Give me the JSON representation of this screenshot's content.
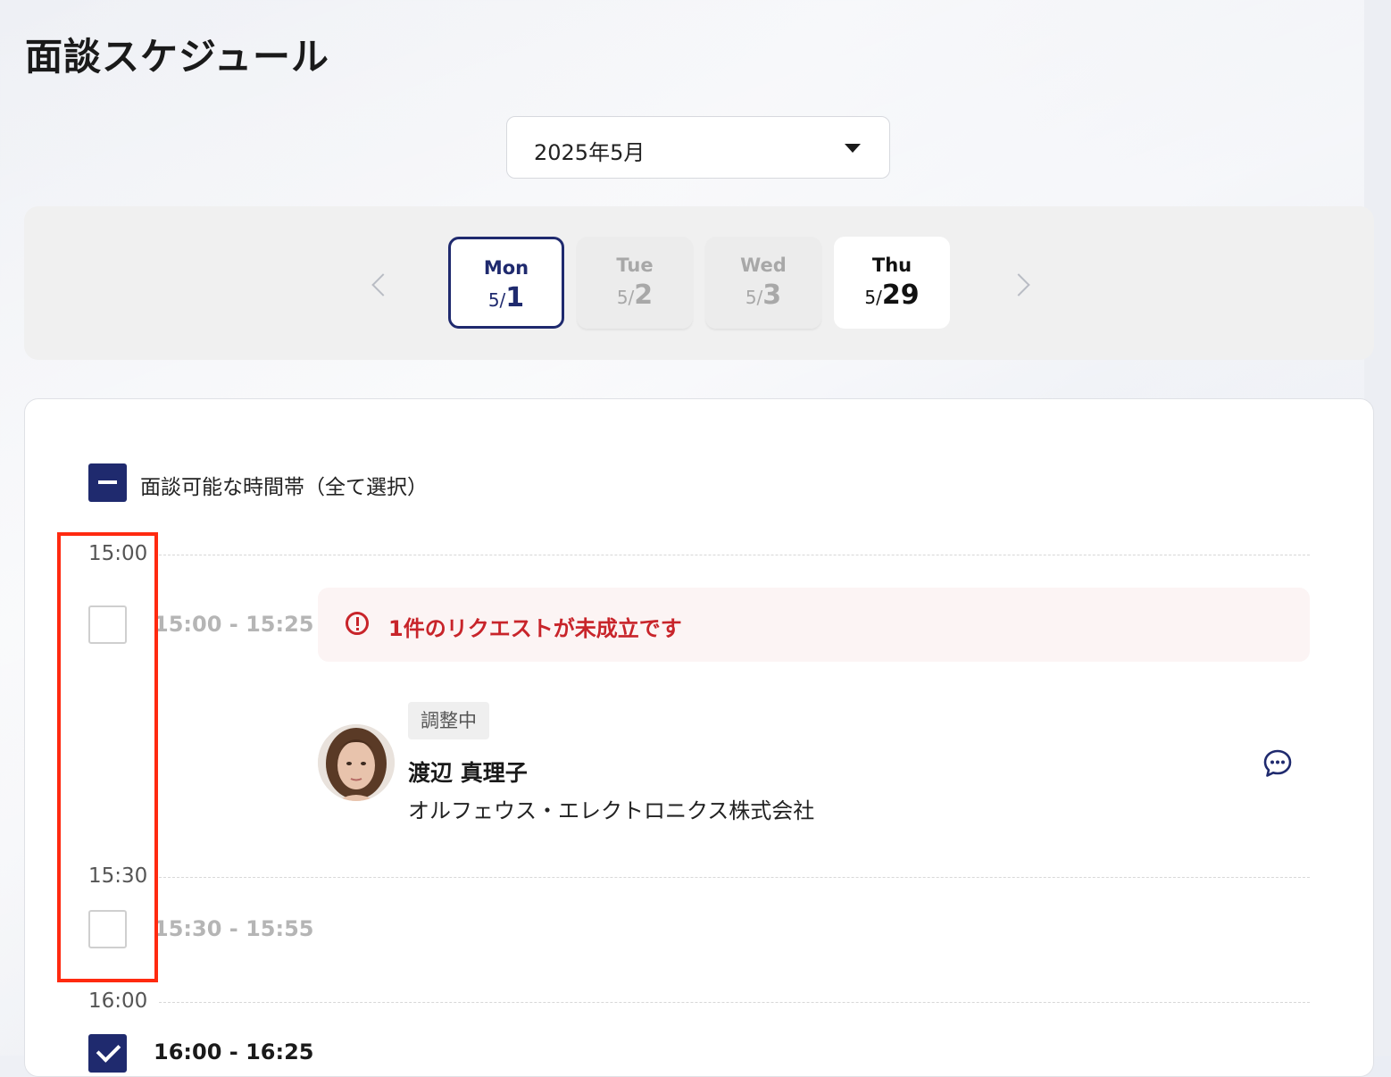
{
  "page": {
    "title": "面談スケジュール"
  },
  "month_select": {
    "value": "2025年5月"
  },
  "days": [
    {
      "dow": "Mon",
      "month": "5/",
      "day": "1",
      "state": "selected"
    },
    {
      "dow": "Tue",
      "month": "5/",
      "day": "2",
      "state": "disabled"
    },
    {
      "dow": "Wed",
      "month": "5/",
      "day": "3",
      "state": "disabled"
    },
    {
      "dow": "Thu",
      "month": "5/",
      "day": "29",
      "state": "available"
    }
  ],
  "schedule": {
    "select_all_label": "面談可能な時間帯（全て選択）",
    "times": [
      "15:00",
      "15:30",
      "16:00"
    ],
    "slots": [
      {
        "range": "15:00 - 15:25",
        "checked": false
      },
      {
        "range": "15:30 - 15:55",
        "checked": false
      },
      {
        "range": "16:00 - 16:25",
        "checked": true
      }
    ],
    "alert": {
      "text": "1件のリクエストが未成立です"
    },
    "request": {
      "status": "調整中",
      "name": "渡辺 真理子",
      "company": "オルフェウス・エレクトロニクス株式会社"
    }
  },
  "colors": {
    "accent": "#1f2a6e",
    "alert": "#c8242a",
    "highlight": "#ff2a10"
  }
}
